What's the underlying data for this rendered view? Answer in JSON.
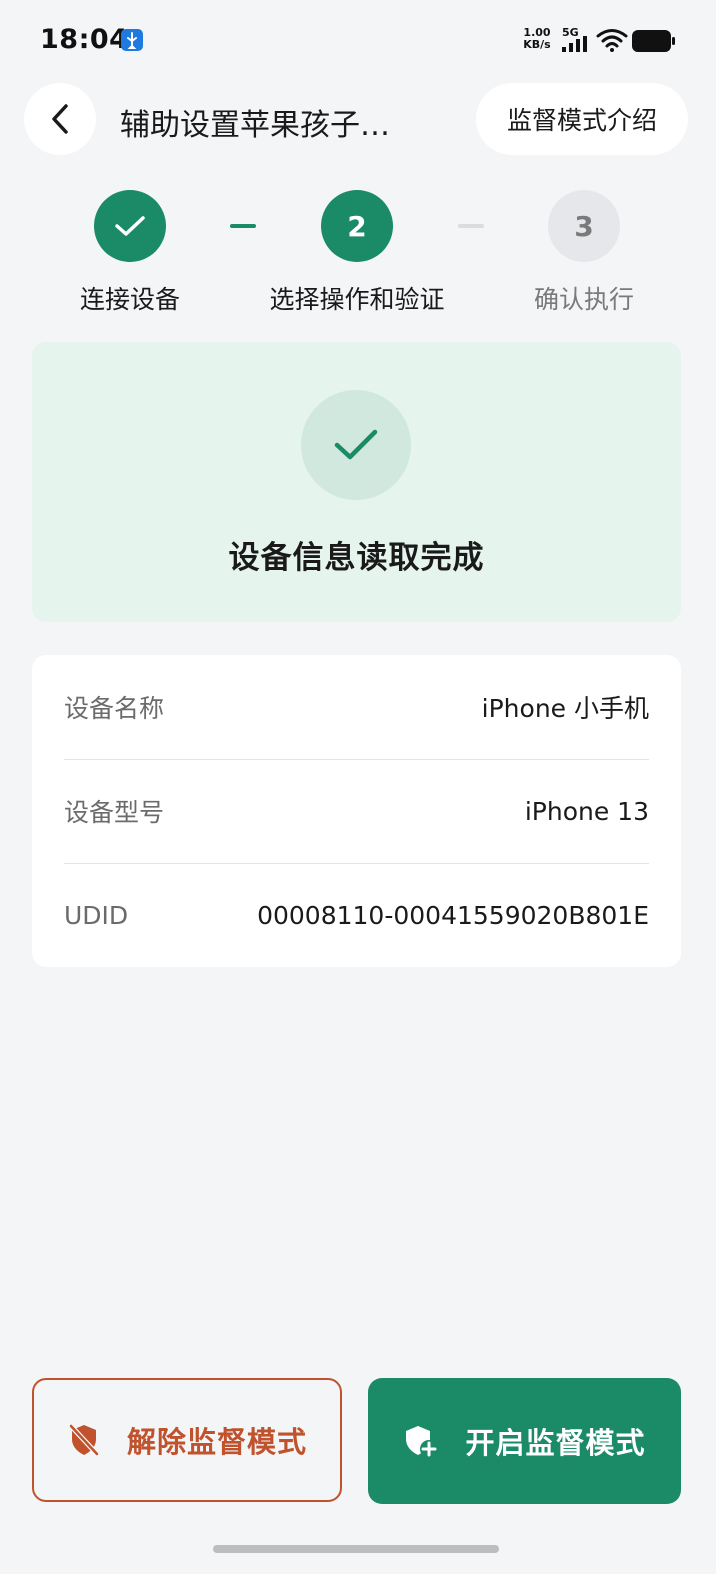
{
  "status_bar": {
    "time": "18:04",
    "net_speed_value": "1.00",
    "net_speed_unit": "KB/s",
    "network_type": "5G"
  },
  "header": {
    "title": "辅助设置苹果孩子…",
    "intro_button_label": "监督模式介绍"
  },
  "steps": [
    {
      "label": "连接设备",
      "state": "done",
      "number": "1"
    },
    {
      "label": "选择操作和验证",
      "state": "active",
      "number": "2"
    },
    {
      "label": "确认执行",
      "state": "pending",
      "number": "3"
    }
  ],
  "success_card": {
    "message": "设备信息读取完成"
  },
  "device_info": [
    {
      "label": "设备名称",
      "value": "iPhone 小手机"
    },
    {
      "label": "设备型号",
      "value": "iPhone 13"
    },
    {
      "label": "UDID",
      "value": "00008110-00041559020B801E"
    }
  ],
  "actions": {
    "exit_supervision_label": "解除监督模式",
    "enable_supervision_label": "开启监督模式"
  },
  "colors": {
    "accent": "#1a8a67",
    "danger": "#c0532d",
    "success_bg": "#e6f4ee"
  }
}
